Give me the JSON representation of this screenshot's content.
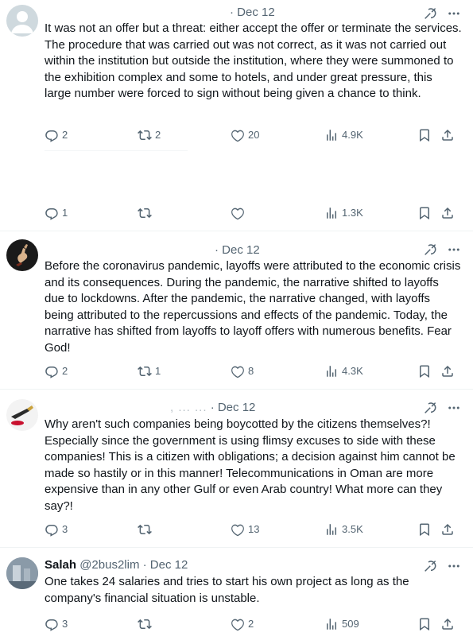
{
  "tweets": [
    {
      "author_name": "",
      "handle": "",
      "date": "· Dec 12",
      "text": "It was not an offer but a threat: either accept the offer or terminate the services. The procedure that was carried out was not correct, as it was not carried out within the institution but outside the institution, where they were summoned to the exhibition complex and some to hotels, and under great pressure, this large number were forced to sign without being given a chance to think.",
      "replies": "2",
      "reposts": "2",
      "likes": "20",
      "views": "4.9K"
    },
    {
      "author_name": "",
      "handle": "",
      "date": "",
      "text": "",
      "replies": "1",
      "reposts": "",
      "likes": "",
      "views": "1.3K"
    },
    {
      "author_name": "",
      "handle": "",
      "date": "· Dec 12",
      "text": "Before the coronavirus pandemic, layoffs were attributed to the economic crisis and its consequences. During the pandemic, the narrative shifted to layoffs due to lockdowns. After the pandemic, the narrative changed, with layoffs being attributed to the repercussions and effects of the pandemic. Today, the narrative has shifted from layoffs to layoff offers with numerous benefits. Fear God!",
      "replies": "2",
      "reposts": "1",
      "likes": "8",
      "views": "4.3K"
    },
    {
      "author_name": "",
      "handle": ", ... ...",
      "date": "· Dec 12",
      "text": "Why aren't such companies being boycotted by the citizens themselves?! Especially since the government is using flimsy excuses to side with these companies! This is a citizen with obligations; a decision against him cannot be made so hastily or in this manner! Telecommunications in Oman are more expensive than in any other Gulf or even Arab country! What more can they say?!",
      "replies": "3",
      "reposts": "",
      "likes": "13",
      "views": "3.5K"
    },
    {
      "author_name": "Salah",
      "handle": "@2bus2lim",
      "date": "· Dec 12",
      "text": "One takes 24 salaries and tries to start his own project as long as the company's financial situation is unstable.",
      "replies": "3",
      "reposts": "",
      "likes": "2",
      "views": "509"
    }
  ],
  "icons": {
    "reply": "reply-icon",
    "repost": "repost-icon",
    "like": "heart-icon",
    "views": "views-icon",
    "bookmark": "bookmark-icon",
    "share": "share-icon",
    "grok": "grok-icon",
    "more": "more-icon"
  },
  "colors": {
    "text": "#0f1419",
    "secondary": "#536471",
    "divider": "#eff3f4"
  }
}
